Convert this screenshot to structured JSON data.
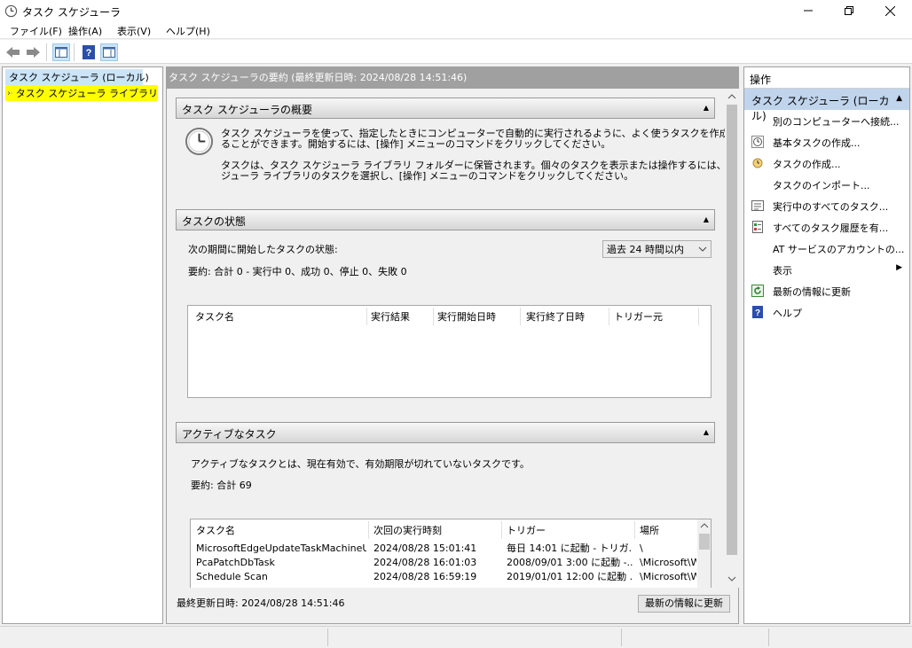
{
  "window": {
    "title": "タスク スケジューラ"
  },
  "menu": {
    "file": "ファイル(F)",
    "action": "操作(A)",
    "view": "表示(V)",
    "help": "ヘルプ(H)"
  },
  "tree": {
    "root": "タスク スケジューラ (ローカル)",
    "library": "タスク スケジューラ ライブラリ"
  },
  "center": {
    "header": "タスク スケジューラの要約 (最終更新日時: 2024/08/28 14:51:46)",
    "overview": {
      "title": "タスク スケジューラの概要",
      "p1_l1": "タスク スケジューラを使って、指定したときにコンピューターで自動的に実行されるように、よく使うタスクを作成し管理す",
      "p1_l2": "ることができます。開始するには、[操作] メニューのコマンドをクリックしてください。",
      "p2_l1": "タスクは、タスク スケジューラ ライブラリ フォルダーに保管されます。個々のタスクを表示または操作するには、タスク スケ",
      "p2_l2": "ジューラ ライブラリのタスクを選択し、[操作] メニューのコマンドをクリックしてください。"
    },
    "status": {
      "title": "タスクの状態",
      "period_label": "次の期間に開始したタスクの状態:",
      "period_value": "過去 24 時間以内",
      "summary": "要約: 合計 0 - 実行中 0、成功 0、停止 0、失敗 0",
      "columns": [
        "タスク名",
        "実行結果",
        "実行開始日時",
        "実行終了日時",
        "トリガー元"
      ]
    },
    "active": {
      "title": "アクティブなタスク",
      "desc": "アクティブなタスクとは、現在有効で、有効期限が切れていないタスクです。",
      "summary": "要約: 合計 69",
      "columns": [
        "タスク名",
        "次回の実行時刻",
        "トリガー",
        "場所"
      ],
      "rows": [
        [
          "MicrosoftEdgeUpdateTaskMachineUA",
          "2024/08/28 15:01:41",
          "毎日 14:01 に起動 - トリガ...",
          "\\"
        ],
        [
          "PcaPatchDbTask",
          "2024/08/28 16:01:03",
          "2008/09/01 3:00 に起動 -...",
          "\\Microsoft\\W"
        ],
        [
          "Schedule Scan",
          "2024/08/28 16:59:19",
          "2019/01/01 12:00 に起動 ...",
          "\\Microsoft\\W"
        ]
      ]
    },
    "footer": {
      "last_updated": "最終更新日時: 2024/08/28 14:51:46",
      "refresh_button": "最新の情報に更新"
    }
  },
  "actions": {
    "title": "操作",
    "selected": "タスク スケジューラ (ローカル)",
    "items": {
      "connect": "別のコンピューターへ接続...",
      "basic": "基本タスクの作成...",
      "create": "タスクの作成...",
      "import": "タスクのインポート...",
      "running": "実行中のすべてのタスク...",
      "history": "すべてのタスク履歴を有...",
      "at": "AT サービスのアカウントの...",
      "view": "表示",
      "refresh": "最新の情報に更新",
      "help": "ヘルプ"
    }
  },
  "colors": {
    "selection": "#c0d4ec",
    "highlight": "#ffff00",
    "header_gray": "#a0a0a0"
  }
}
